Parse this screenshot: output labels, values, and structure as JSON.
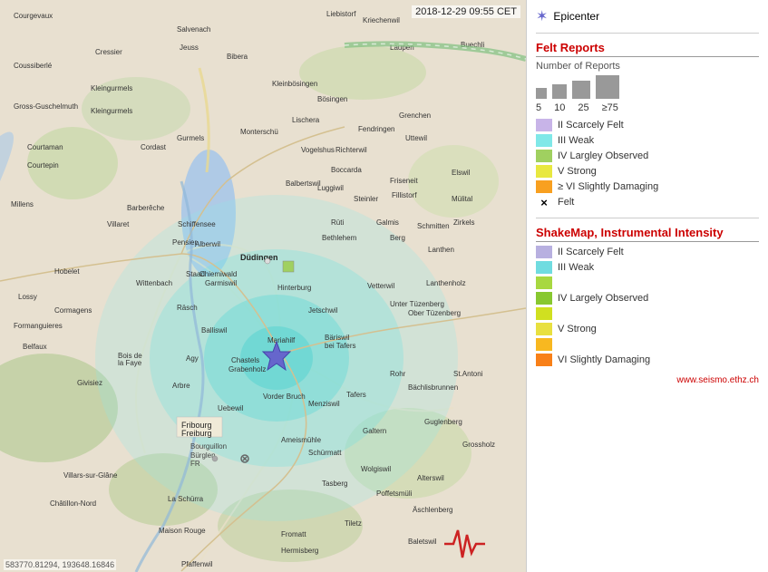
{
  "timestamp": "2018-12-29 09:55 CET",
  "coords": "583770.81294, 193648.16846",
  "seismo_credit": "www.seismo.ethz.ch",
  "epicenter_label": "Epicenter",
  "felt_reports": {
    "title": "Felt Reports",
    "subtitle": "Number of Reports",
    "counts": [
      "5",
      "10",
      "25",
      "≥75"
    ],
    "items": [
      {
        "label": "II Scarcely Felt",
        "color": "#c8b4e8"
      },
      {
        "label": "III Weak",
        "color": "#80e8e8"
      },
      {
        "label": "IV Largley Observed",
        "color": "#a0d060"
      },
      {
        "label": "V Strong",
        "color": "#e8e840"
      },
      {
        "label": "≥ VI Slightly Damaging",
        "color": "#f8a020"
      },
      {
        "label": "Felt",
        "color": null,
        "cross": true
      }
    ]
  },
  "shakemap": {
    "title": "ShakeMap, Instrumental Intensity",
    "items": [
      {
        "label": "II Scarcely Felt",
        "color": "#b8b0e0"
      },
      {
        "label": "III Weak",
        "color": "#70dce0"
      },
      {
        "label": "",
        "color": "#a8d840"
      },
      {
        "label": "IV Largely Observed",
        "color": "#88c830"
      },
      {
        "label": "",
        "color": "#d0e020"
      },
      {
        "label": "V Strong",
        "color": "#e8e040"
      },
      {
        "label": "",
        "color": "#f8b820"
      },
      {
        "label": "VI Slightly Damaging",
        "color": "#f88018"
      }
    ]
  }
}
